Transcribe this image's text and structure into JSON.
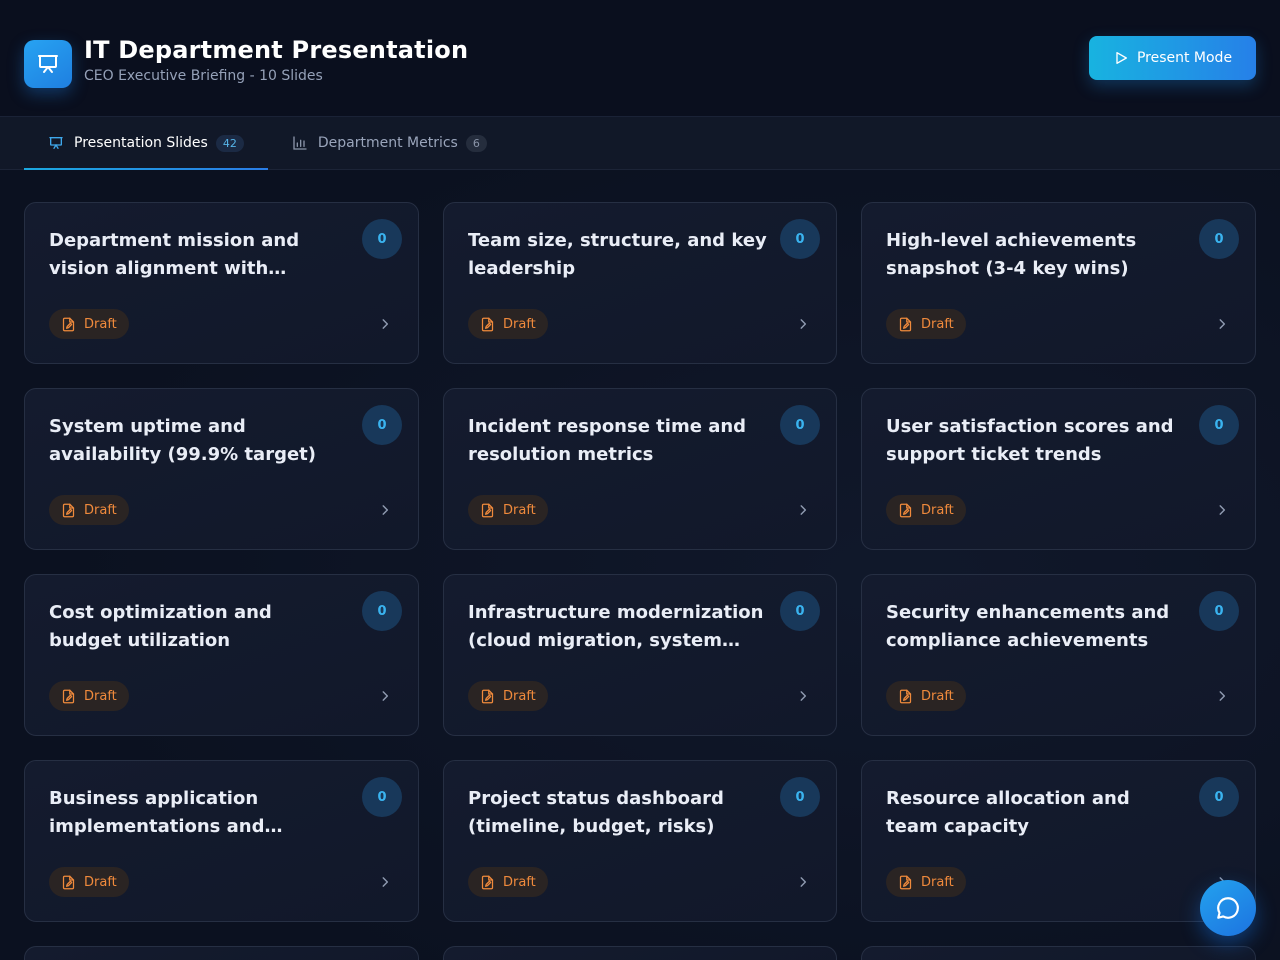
{
  "header": {
    "title": "IT Department Presentation",
    "subtitle": "CEO Executive Briefing - 10 Slides",
    "logo_icon": "presentation-icon",
    "present_button_label": "Present Mode",
    "present_button_icon": "play-icon"
  },
  "tabs": [
    {
      "label": "Presentation Slides",
      "count": "42",
      "icon": "presentation-icon",
      "active": true
    },
    {
      "label": "Department Metrics",
      "count": "6",
      "icon": "bar-chart-icon",
      "active": false
    }
  ],
  "cards": [
    {
      "title": "Department mission and vision alignment with business goals",
      "count": "0",
      "status": "Draft"
    },
    {
      "title": "Team size, structure, and key leadership",
      "count": "0",
      "status": "Draft"
    },
    {
      "title": "High-level achievements snapshot (3-4 key wins)",
      "count": "0",
      "status": "Draft"
    },
    {
      "title": "System uptime and availability (99.9% target)",
      "count": "0",
      "status": "Draft"
    },
    {
      "title": "Incident response time and resolution metrics",
      "count": "0",
      "status": "Draft"
    },
    {
      "title": "User satisfaction scores and support ticket trends",
      "count": "0",
      "status": "Draft"
    },
    {
      "title": "Cost optimization and budget utilization",
      "count": "0",
      "status": "Draft"
    },
    {
      "title": "Infrastructure modernization (cloud migration, system upgrades)",
      "count": "0",
      "status": "Draft"
    },
    {
      "title": "Security enhancements and compliance achievements",
      "count": "0",
      "status": "Draft"
    },
    {
      "title": "Business application implementations and integrations",
      "count": "0",
      "status": "Draft"
    },
    {
      "title": "Project status dashboard (timeline, budget, risks)",
      "count": "0",
      "status": "Draft"
    },
    {
      "title": "Resource allocation and team capacity",
      "count": "0",
      "status": "Draft"
    }
  ],
  "colors": {
    "accent": "#1ea5e6",
    "draft": "#f08a3c",
    "background": "#0b1120"
  },
  "fab_icon": "chat-icon"
}
